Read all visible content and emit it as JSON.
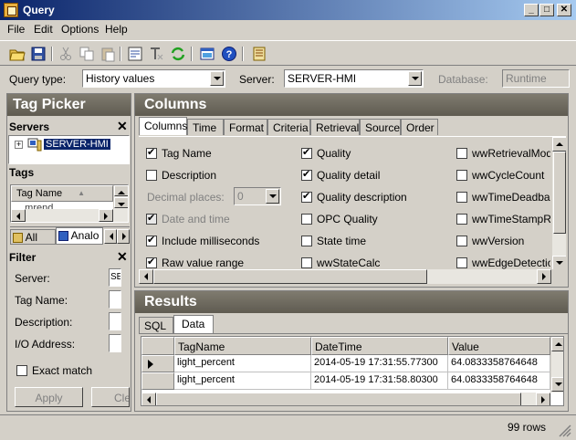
{
  "window": {
    "title": "Query"
  },
  "menu": [
    {
      "label": "File"
    },
    {
      "label": "Edit"
    },
    {
      "label": "Options"
    },
    {
      "label": "Help"
    }
  ],
  "toolbar": {
    "icons": [
      "open-folder-icon",
      "save-icon",
      "cut-icon",
      "copy-icon",
      "paste-icon",
      "properties-icon",
      "clear-text-icon",
      "refresh-icon",
      "view-icon",
      "help-icon",
      "build-icon"
    ]
  },
  "query_bar": {
    "query_type_label": "Query type:",
    "query_type_value": "History values",
    "server_label": "Server:",
    "server_value": "SERVER-HMI",
    "database_label": "Database:",
    "database_value": "Runtime"
  },
  "tag_picker": {
    "title": "Tag Picker",
    "servers_header": "Servers",
    "server_node": "SERVER-HMI",
    "tags_header": "Tags",
    "tag_column": "Tag Name",
    "tag_partial": "...mrend",
    "tabs": [
      {
        "label": "All"
      },
      {
        "label": "Analo"
      }
    ],
    "filter": {
      "header": "Filter",
      "server_label": "Server:",
      "server_value": "SE",
      "tagname_label": "Tag Name:",
      "description_label": "Description:",
      "io_label": "I/O Address:",
      "exact_match": "Exact match",
      "apply": "Apply",
      "clear": "Cle"
    }
  },
  "columns": {
    "title": "Columns",
    "tabs": [
      {
        "label": "Columns"
      },
      {
        "label": "Time"
      },
      {
        "label": "Format"
      },
      {
        "label": "Criteria"
      },
      {
        "label": "Retrieval"
      },
      {
        "label": "Source"
      },
      {
        "label": "Order"
      }
    ],
    "col1": [
      {
        "label": "Tag Name",
        "checked": true
      },
      {
        "label": "Description",
        "checked": false
      },
      {
        "label": "Decimal places:",
        "value": "0"
      },
      {
        "label": "Date and time",
        "checked": true,
        "disabled": true
      },
      {
        "label": "Include milliseconds",
        "checked": true
      },
      {
        "label": "Raw value range",
        "checked": true
      }
    ],
    "col2": [
      {
        "label": "Quality",
        "checked": true
      },
      {
        "label": "Quality detail",
        "checked": true
      },
      {
        "label": "Quality description",
        "checked": true
      },
      {
        "label": "OPC Quality",
        "checked": false
      },
      {
        "label": "State time",
        "checked": false
      },
      {
        "label": "wwStateCalc",
        "checked": false
      }
    ],
    "col3": [
      {
        "label": "wwRetrievalMode",
        "checked": false
      },
      {
        "label": "wwCycleCount",
        "checked": false
      },
      {
        "label": "wwTimeDeadband",
        "checked": false
      },
      {
        "label": "wwTimeStampRule",
        "checked": false
      },
      {
        "label": "wwVersion",
        "checked": false
      },
      {
        "label": "wwEdgeDetection",
        "checked": false
      }
    ]
  },
  "results": {
    "title": "Results",
    "tabs": [
      {
        "label": "SQL"
      },
      {
        "label": "Data"
      }
    ],
    "headers": [
      "TagName",
      "DateTime",
      "Value"
    ],
    "rows": [
      [
        "light_percent",
        "2014-05-19 17:31:55.77300",
        "64.0833358764648"
      ],
      [
        "light_percent",
        "2014-05-19 17:31:58.80300",
        "64.0833358764648"
      ]
    ]
  },
  "status": {
    "rows": "99 rows"
  }
}
